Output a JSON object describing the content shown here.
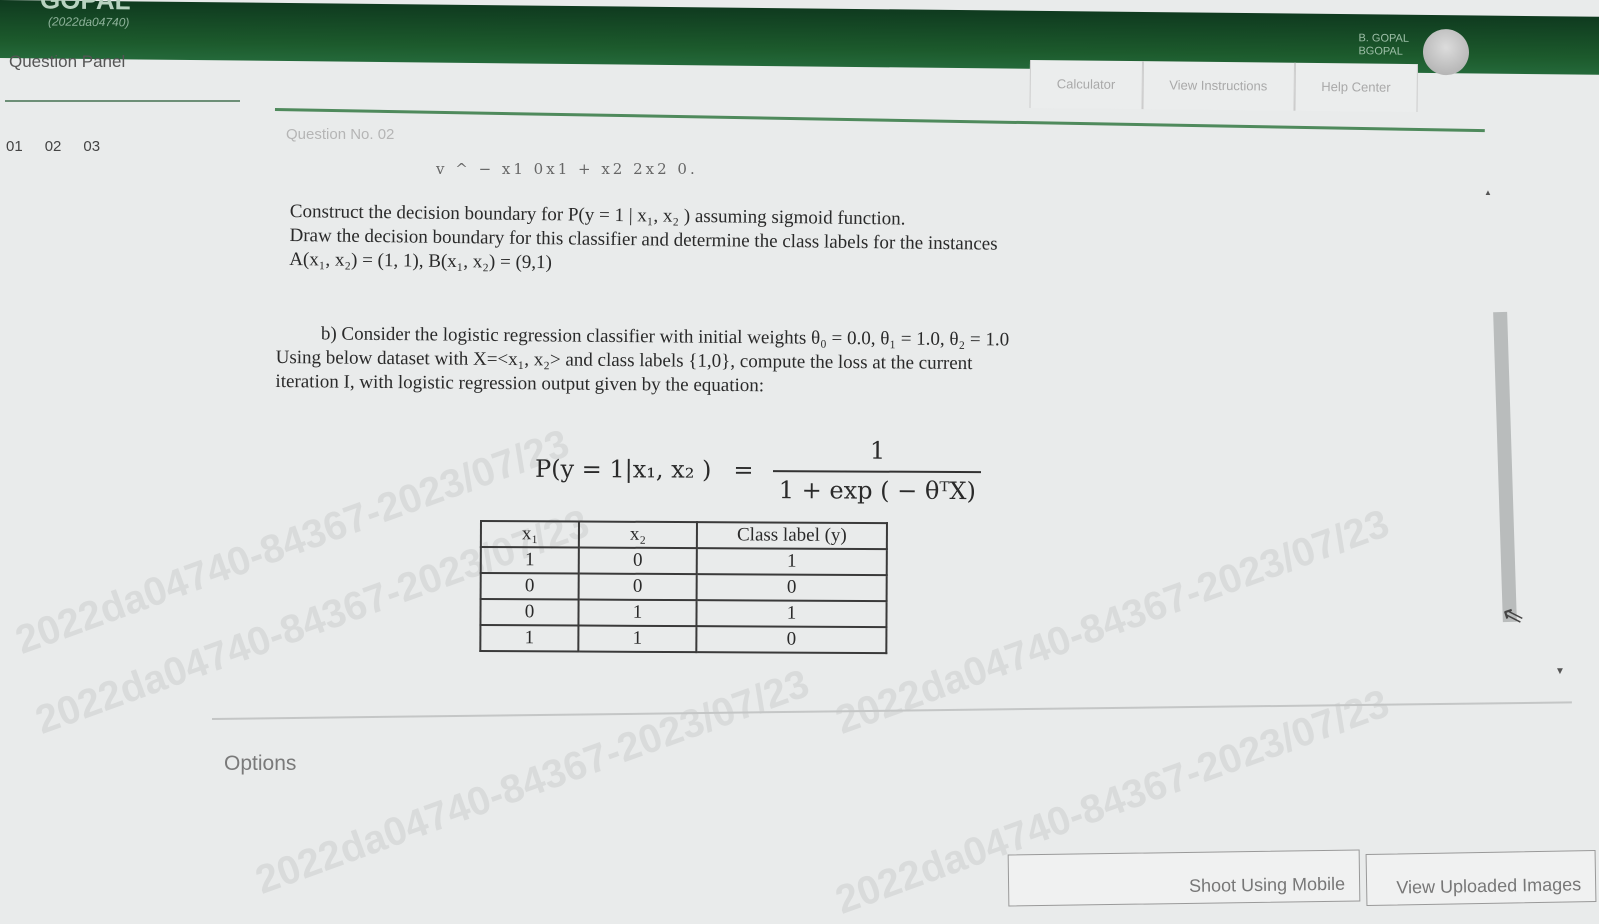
{
  "header": {
    "brand": "GOPAL",
    "roll_no": "(2022da04740)",
    "user_name": "B. GOPAL",
    "user_id": "BGOPAL"
  },
  "question_panel": {
    "title": "Question Panel",
    "numbers": [
      "01",
      "02",
      "03"
    ]
  },
  "toolbar": {
    "calculator": "Calculator",
    "view_instructions": "View Instructions",
    "help_center": "Help Center"
  },
  "question": {
    "label": "Question No. 02",
    "cutoff_line": "v ^ − x1   0x1 + x2   2x2   0.",
    "part_a_line1": "Construct the decision boundary for P(y = 1 | x₁, x₂ ) assuming sigmoid function.",
    "part_a_line2": "Draw the decision boundary for this classifier and determine the class labels for the instances",
    "part_a_line3": "A(x₁, x₂) = (1, 1), B(x₁, x₂) = (9,1)",
    "part_b_line1": "b) Consider the logistic regression classifier with initial weights θ₀ = 0.0, θ₁ = 1.0, θ₂ = 1.0",
    "part_b_line2": "Using below dataset with X=<x₁, x₂> and class labels {1,0}, compute the loss at the current",
    "part_b_line3": "iteration I, with logistic regression output given by the equation:",
    "formula_lhs": "P(y = 1|x₁, x₂ )",
    "formula_eq": "=",
    "formula_num": "1",
    "formula_den": "1 + exp ( − θᵀX)"
  },
  "dataset": {
    "headers": [
      "x₁",
      "x₂",
      "Class label (y)"
    ],
    "rows": [
      [
        "1",
        "0",
        "1"
      ],
      [
        "0",
        "0",
        "0"
      ],
      [
        "0",
        "1",
        "1"
      ],
      [
        "1",
        "1",
        "0"
      ]
    ]
  },
  "options_label": "Options",
  "bottom_buttons": {
    "shoot_mobile": "Shoot Using Mobile",
    "view_uploaded": "View Uploaded Images"
  },
  "watermark": "2022da04740-84367-2023/07/23"
}
